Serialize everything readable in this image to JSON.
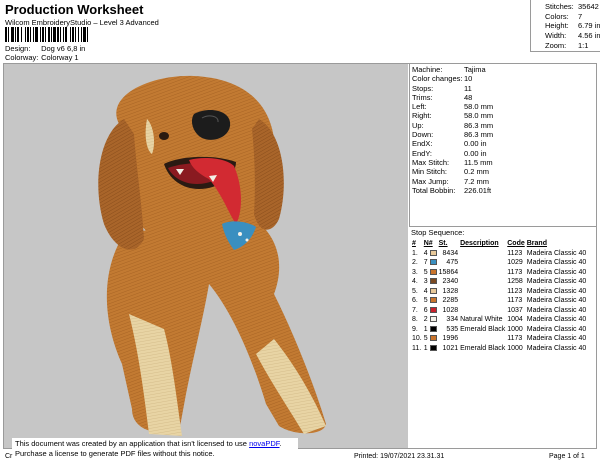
{
  "header": {
    "title": "Production Worksheet",
    "subtitle": "Wilcom EmbroideryStudio – Level 3 Advanced",
    "design_label": "Design:",
    "design_value": "Dog v6 6,8 in",
    "colorway_label": "Colorway:",
    "colorway_value": "Colorway 1"
  },
  "top_stats": [
    {
      "label": "Stitches:",
      "value": "35642"
    },
    {
      "label": "Colors:",
      "value": "7"
    },
    {
      "label": "Height:",
      "value": "6.79 in"
    },
    {
      "label": "Width:",
      "value": "4.56 in"
    },
    {
      "label": "Zoom:",
      "value": "1:1"
    }
  ],
  "details": [
    {
      "label": "Machine:",
      "value": "Tajima"
    },
    {
      "label": "Color changes:",
      "value": "10"
    },
    {
      "label": "Stops:",
      "value": "11"
    },
    {
      "label": "Trims:",
      "value": "48"
    },
    {
      "label": "Left:",
      "value": "58.0 mm"
    },
    {
      "label": "Right:",
      "value": "58.0 mm"
    },
    {
      "label": "Up:",
      "value": "86.3 mm"
    },
    {
      "label": "Down:",
      "value": "86.3 mm"
    },
    {
      "label": "EndX:",
      "value": "0.00 in"
    },
    {
      "label": "EndY:",
      "value": "0.00 in"
    },
    {
      "label": "Max Stitch:",
      "value": "11.5 mm"
    },
    {
      "label": "Min Stitch:",
      "value": "0.2 mm"
    },
    {
      "label": "Max Jump:",
      "value": "7.2 mm"
    },
    {
      "label": "Total Bobbin:",
      "value": "226.01ft"
    }
  ],
  "stop_sequence": {
    "title": "Stop Sequence:",
    "columns": [
      "#",
      "N#",
      "St.",
      "Description",
      "Code",
      "Brand"
    ],
    "rows": [
      {
        "idx": "1.",
        "n": "4",
        "color": "#e8c99a",
        "st": "8434",
        "desc": "",
        "code": "1123",
        "brand": "Madeira Classic 40"
      },
      {
        "idx": "2.",
        "n": "7",
        "color": "#3a8fc0",
        "st": "475",
        "desc": "",
        "code": "1029",
        "brand": "Madeira Classic 40"
      },
      {
        "idx": "3.",
        "n": "5",
        "color": "#c9742c",
        "st": "15864",
        "desc": "",
        "code": "1173",
        "brand": "Madeira Classic 40"
      },
      {
        "idx": "4.",
        "n": "3",
        "color": "#7a4a22",
        "st": "2340",
        "desc": "",
        "code": "1258",
        "brand": "Madeira Classic 40"
      },
      {
        "idx": "5.",
        "n": "4",
        "color": "#e8c99a",
        "st": "1328",
        "desc": "",
        "code": "1123",
        "brand": "Madeira Classic 40"
      },
      {
        "idx": "6.",
        "n": "5",
        "color": "#c9742c",
        "st": "2285",
        "desc": "",
        "code": "1173",
        "brand": "Madeira Classic 40"
      },
      {
        "idx": "7.",
        "n": "6",
        "color": "#c8202a",
        "st": "1028",
        "desc": "",
        "code": "1037",
        "brand": "Madeira Classic 40"
      },
      {
        "idx": "8.",
        "n": "2",
        "color": "#f4f2ea",
        "st": "334",
        "desc": "Natural White",
        "code": "1004",
        "brand": "Madeira Classic 40"
      },
      {
        "idx": "9.",
        "n": "1",
        "color": "#000000",
        "st": "535",
        "desc": "Emerald Black",
        "code": "1000",
        "brand": "Madeira Classic 40"
      },
      {
        "idx": "10.",
        "n": "5",
        "color": "#c9742c",
        "st": "1996",
        "desc": "",
        "code": "1173",
        "brand": "Madeira Classic 40"
      },
      {
        "idx": "11.",
        "n": "1",
        "color": "#000000",
        "st": "1021",
        "desc": "Emerald Black",
        "code": "1000",
        "brand": "Madeira Classic 40"
      }
    ]
  },
  "notice": {
    "line1": "This document was created by an application that isn't licensed to use",
    "link": "novaPDF",
    "line1_end": ".",
    "line2": "Purchase a license to generate PDF files without this notice."
  },
  "footer": {
    "cr": "Cr",
    "printed": "Printed: 19/07/2021 23.31.31",
    "page": "Page 1 of 1"
  }
}
